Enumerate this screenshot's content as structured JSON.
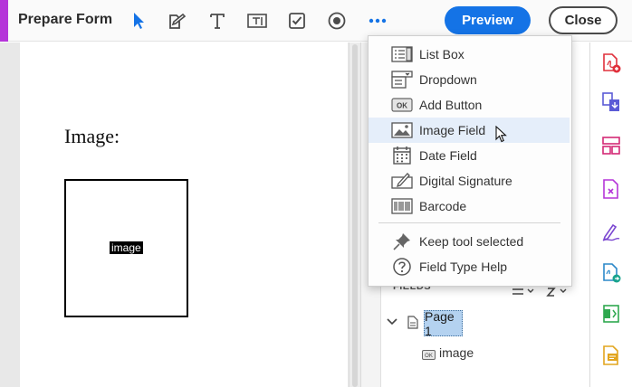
{
  "toolbar": {
    "title": "Prepare Form",
    "accent_color": "#b535d9",
    "tools": [
      {
        "icon": "select-pointer-icon"
      },
      {
        "icon": "edit-form-icon"
      },
      {
        "icon": "text-tool-icon"
      },
      {
        "icon": "text-field-icon"
      },
      {
        "icon": "checkbox-icon"
      },
      {
        "icon": "radio-button-icon"
      },
      {
        "icon": "more-options-icon"
      }
    ],
    "preview_label": "Preview",
    "close_label": "Close",
    "primary_color": "#1473e6"
  },
  "document": {
    "label_text": "Image:",
    "field_tag": "image"
  },
  "menu": {
    "items": [
      {
        "label": "List Box",
        "icon": "list-box-icon",
        "hovered": false
      },
      {
        "label": "Dropdown",
        "icon": "dropdown-icon",
        "hovered": false
      },
      {
        "label": "Add Button",
        "icon": "add-button-icon",
        "hovered": false
      },
      {
        "label": "Image Field",
        "icon": "image-field-icon",
        "hovered": true
      },
      {
        "label": "Date Field",
        "icon": "date-field-icon",
        "hovered": false
      },
      {
        "label": "Digital Signature",
        "icon": "digital-signature-icon",
        "hovered": false
      },
      {
        "label": "Barcode",
        "icon": "barcode-icon",
        "hovered": false
      }
    ],
    "extra_items": [
      {
        "label": "Keep tool selected",
        "icon": "pin-icon"
      },
      {
        "label": "Field Type Help",
        "icon": "help-icon"
      }
    ],
    "hover_color": "#e5eefa"
  },
  "fields_panel": {
    "heading": "FIELDS",
    "tree": [
      {
        "label": "Page 1",
        "expanded": true,
        "children": [
          {
            "label": "image",
            "icon": "button-field-icon"
          }
        ]
      }
    ]
  },
  "right_rail": {
    "tools": [
      {
        "icon": "create-pdf-icon"
      },
      {
        "icon": "combine-files-icon"
      },
      {
        "icon": "organize-pages-icon"
      },
      {
        "icon": "edit-pdf-icon"
      },
      {
        "icon": "fill-sign-icon"
      },
      {
        "icon": "export-pdf-icon"
      },
      {
        "icon": "compress-pdf-icon"
      },
      {
        "icon": "comment-icon"
      }
    ]
  }
}
